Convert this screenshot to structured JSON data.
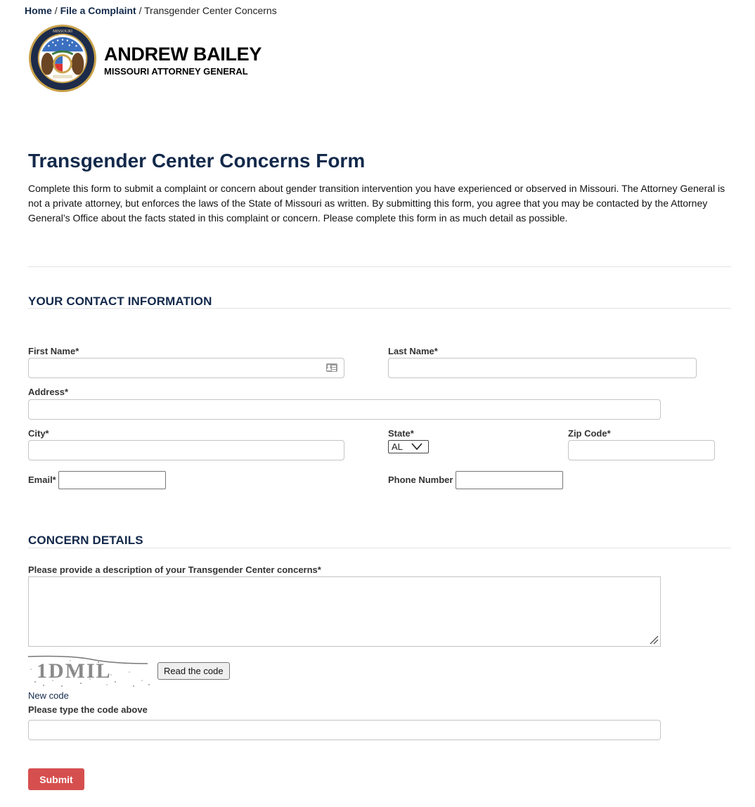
{
  "breadcrumb": {
    "items": [
      {
        "label": "Home"
      },
      {
        "label": "File a Complaint"
      },
      {
        "label": "Transgender Center Concerns"
      }
    ],
    "separator": "/"
  },
  "header": {
    "name": "ANDREW BAILEY",
    "subtitle": "MISSOURI ATTORNEY GENERAL",
    "seal_icon": "missouri-attorney-general-seal"
  },
  "page": {
    "title": "Transgender Center Concerns Form",
    "intro": "Complete this form to submit a complaint or concern about gender transition intervention you have experienced or observed in Missouri. The Attorney General is not a private attorney, but enforces the laws of the State of Missouri as written. By submitting this form, you agree that you may be contacted by the Attorney General’s Office about the facts stated in this complaint or concern. Please complete this form in as much detail as possible."
  },
  "contact": {
    "section_title": "YOUR CONTACT INFORMATION",
    "first_name": {
      "label": "First Name*",
      "value": "",
      "icon": "contact-card-icon"
    },
    "last_name": {
      "label": "Last Name*",
      "value": ""
    },
    "address": {
      "label": "Address*",
      "value": ""
    },
    "city": {
      "label": "City*",
      "value": ""
    },
    "state": {
      "label": "State*",
      "selected": "AL"
    },
    "zip": {
      "label": "Zip Code*",
      "value": ""
    },
    "email": {
      "label": "Email*",
      "value": ""
    },
    "phone": {
      "label": "Phone Number",
      "value": ""
    }
  },
  "concern": {
    "section_title": "CONCERN DETAILS",
    "description": {
      "label": "Please provide a description of your Transgender Center concerns*",
      "value": ""
    },
    "captcha": {
      "code_text": "1DMIL",
      "read_button": "Read the code",
      "new_code_link": "New code",
      "input_label": "Please type the code above",
      "value": ""
    }
  },
  "actions": {
    "submit_label": "Submit"
  },
  "colors": {
    "brand_navy": "#13294b",
    "submit_red": "#d64f4f"
  }
}
